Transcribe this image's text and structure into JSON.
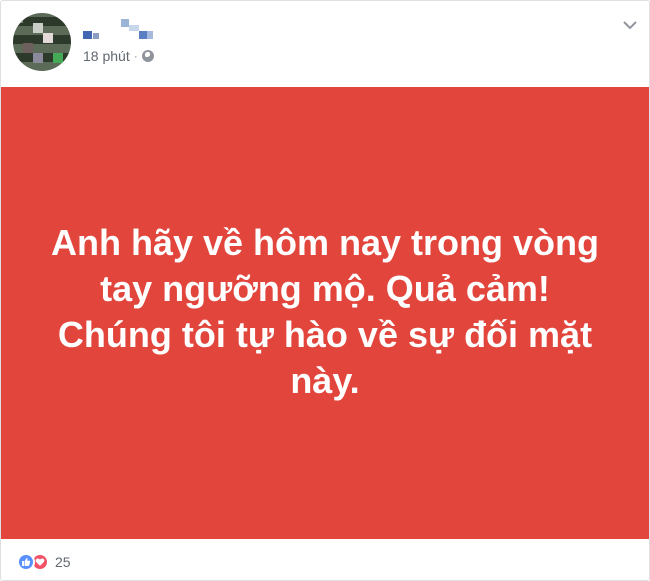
{
  "post": {
    "time_label": "18 phút",
    "privacy_icon": "globe-icon",
    "menu_icon": "chevron-down-icon",
    "banner_background": "#e2453c",
    "banner_lines": [
      "Anh hãy về hôm nay trong vòng",
      "tay ngưỡng mộ. Quả cảm!",
      "Chúng tôi tự hào về sự đối mặt",
      "này."
    ],
    "reaction_icons": [
      "like-icon",
      "love-icon"
    ],
    "reaction_count": "25"
  }
}
